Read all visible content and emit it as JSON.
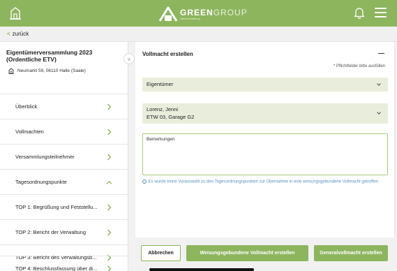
{
  "topbar": {
    "logo_bold": "GREEN",
    "logo_light": "GROUP",
    "logo_sub": "Hausverwaltung"
  },
  "backbar": {
    "back_label": "zurück"
  },
  "sidebar": {
    "meeting_title": "Eigentümerversammlung 2023 (Ordentliche ETV)",
    "address": "Neumarkt 59, 06110 Halle (Saale)",
    "items": [
      {
        "label": "Überblick"
      },
      {
        "label": "Vollmachten"
      },
      {
        "label": "Versammlungsteilnehmer"
      },
      {
        "label": "Tagesordnungspunkte"
      },
      {
        "label": "TOP 1: Begrüßung und Feststellu..."
      },
      {
        "label": "TOP 2: Bericht der Verwaltung"
      },
      {
        "label": "TOP 3: Bericht des Verwaltungsb..."
      },
      {
        "label": "TOP 4: Beschlussfassung über di..."
      }
    ]
  },
  "form": {
    "title": "Vollmacht erstellen",
    "required_note": "* Pflichtfelder bitte ausfüllen",
    "owner_select": "Eigentümer",
    "person_name": "Lorenz, Jenni",
    "person_unit": "ETW 03, Garage G2",
    "remarks_placeholder": "Bemerkungen",
    "info_text": "Es wurde keine Vorauswahl zu den Tagesordnungspunkten zur Übernahme in eine weisungsgebundene Vollmacht getroffen."
  },
  "footer": {
    "cancel_label": "Abbrechen",
    "weisung_label": "Weisungsgebundene Vollmacht erstellen",
    "general_label": "Generalvollmacht erstellen"
  },
  "colors": {
    "accent": "#8db55e",
    "field_bg": "#e9eddc",
    "info": "#5b93c9"
  }
}
